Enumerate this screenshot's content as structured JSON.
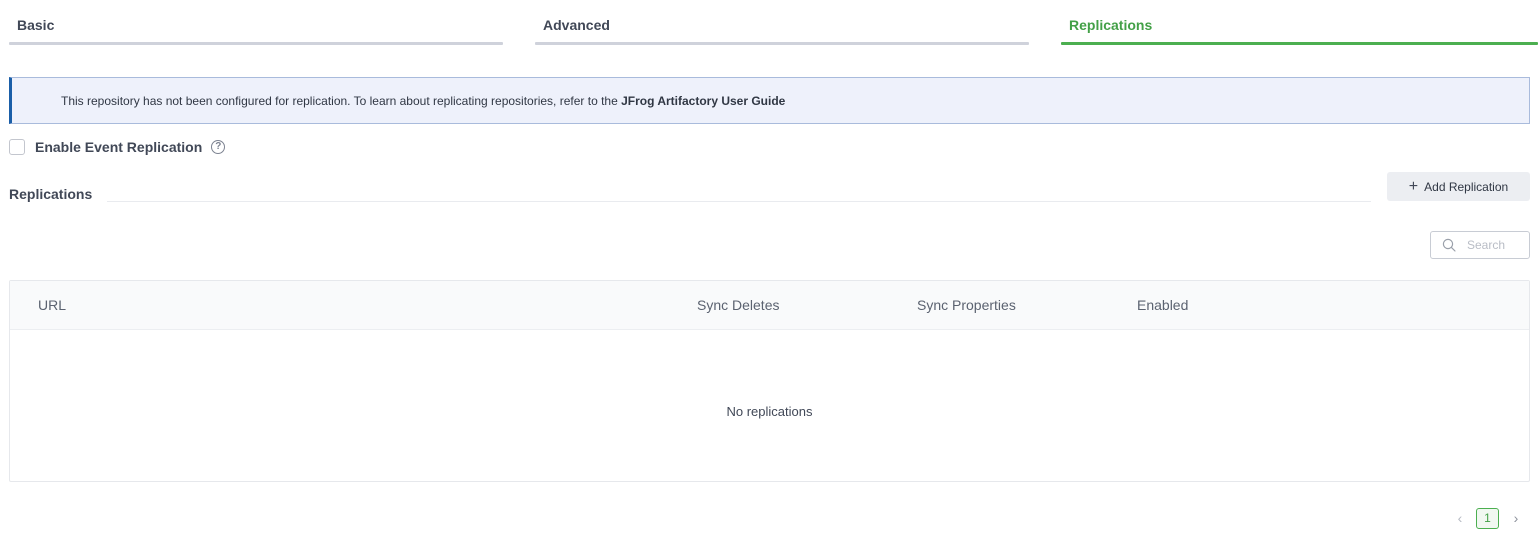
{
  "tabs": [
    {
      "label": "Basic",
      "active": false
    },
    {
      "label": "Advanced",
      "active": false
    },
    {
      "label": "Replications",
      "active": true
    }
  ],
  "banner": {
    "text": "This repository has not been configured for replication. To learn about replicating repositories, refer to the ",
    "link_text": "JFrog Artifactory User Guide"
  },
  "event_replication": {
    "label": "Enable Event Replication",
    "checked": false,
    "help_icon": "question-circle-icon",
    "help_glyph": "?"
  },
  "replications": {
    "title": "Replications",
    "add_button": {
      "label": "Add Replication",
      "icon": "plus-icon",
      "glyph": "+"
    },
    "search": {
      "placeholder": "Search",
      "value": "",
      "icon": "search-icon"
    },
    "table": {
      "columns": [
        "URL",
        "Sync Deletes",
        "Sync Properties",
        "Enabled"
      ],
      "rows": [],
      "empty_text": "No replications"
    }
  },
  "pagination": {
    "prev_glyph": "‹",
    "current_page": "1",
    "next_glyph": "›"
  },
  "colors": {
    "accent": "#4caf50",
    "banner_bg": "#eef1fb",
    "banner_stripe": "#1a5ea8"
  }
}
